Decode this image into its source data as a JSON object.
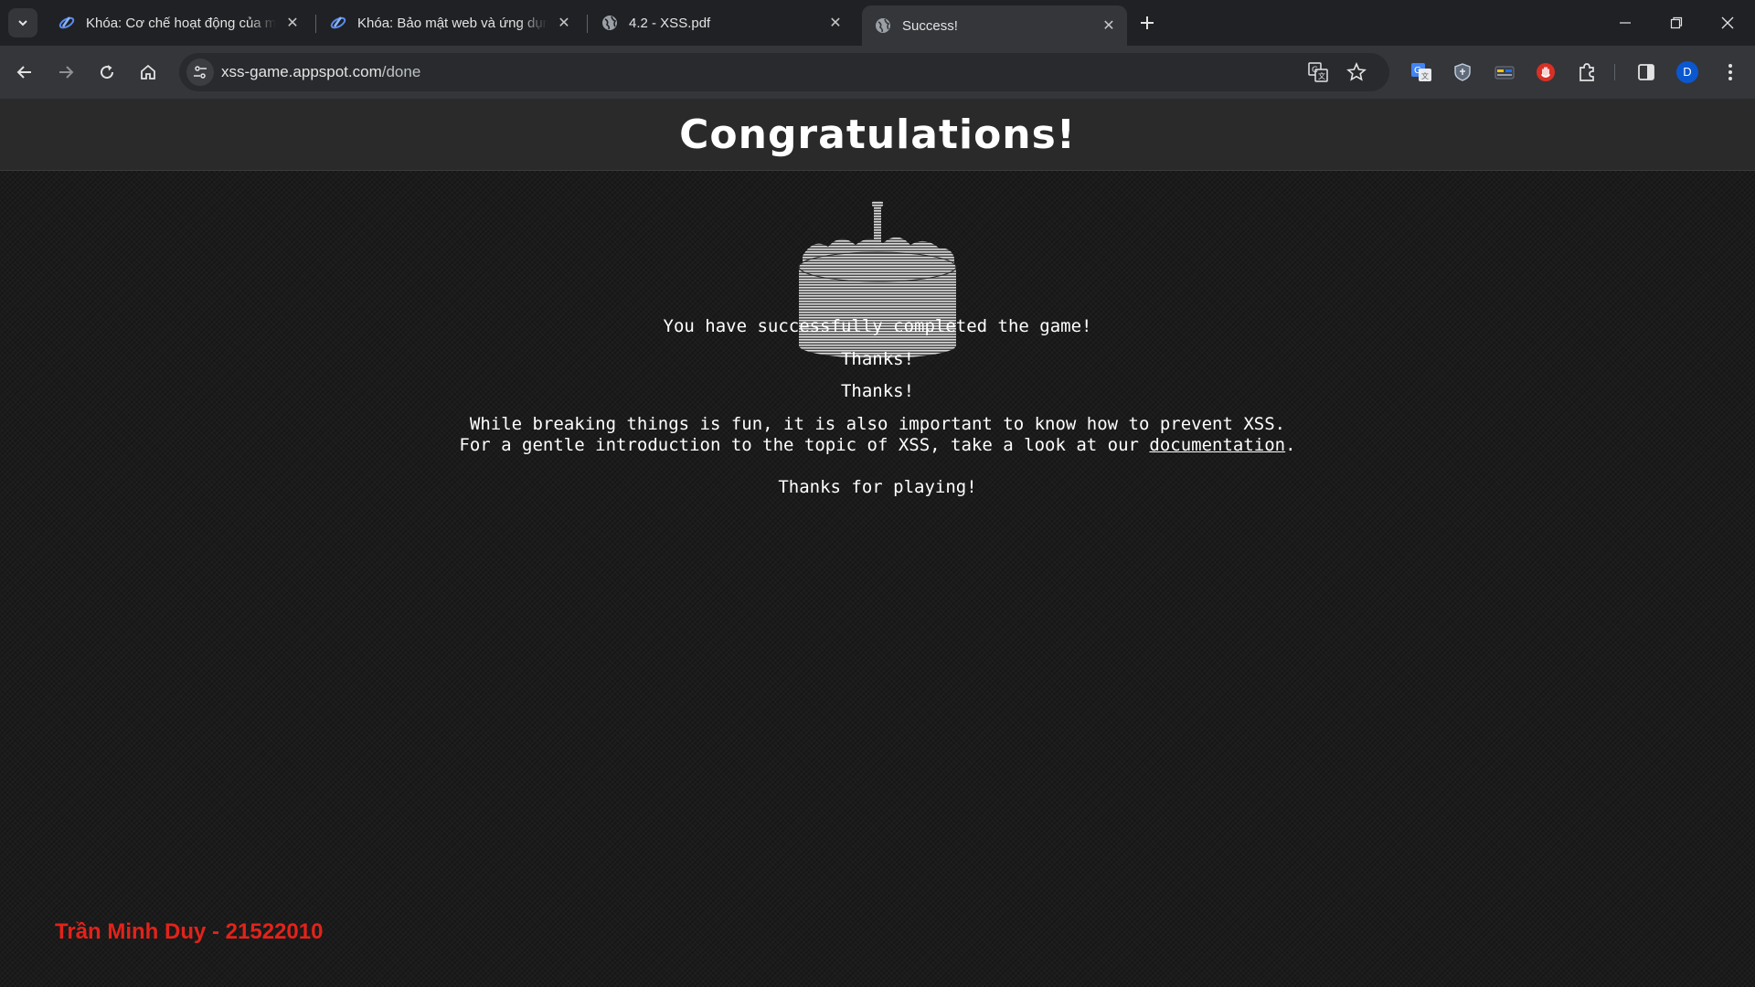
{
  "browser": {
    "tabs": [
      {
        "title": "Khóa: Cơ chế hoạt động của mã",
        "icon": "course-logo-icon",
        "active": false
      },
      {
        "title": "Khóa: Bảo mật web và ứng dụng",
        "icon": "course-logo-icon",
        "active": false
      },
      {
        "title": "4.2 - XSS.pdf",
        "icon": "globe-icon",
        "active": false
      },
      {
        "title": "Success!",
        "icon": "globe-icon",
        "active": true
      }
    ],
    "url_host": "xss-game.appspot.com",
    "url_path": "/done",
    "profile_initial": "D",
    "colors": {
      "profile": "#0b57d0",
      "chrome_bg": "#202124",
      "toolbar_bg": "#35363a"
    }
  },
  "page": {
    "title": "Congratulations!",
    "completed": "You have successfully completed the game!",
    "thanks_1": "Thanks!",
    "thanks_2": "Thanks!",
    "fun_line": "While breaking things is fun, it is also important to know how to prevent XSS.",
    "intro_prefix": "For a gentle introduction to the topic of XSS, take a look at our ",
    "doc_link": "documentation",
    "intro_suffix": ".",
    "thanks_playing": "Thanks for playing!",
    "watermark": "Trần Minh Duy - 21522010",
    "colors": {
      "watermark": "#e2231a",
      "text": "#ffffff"
    }
  }
}
